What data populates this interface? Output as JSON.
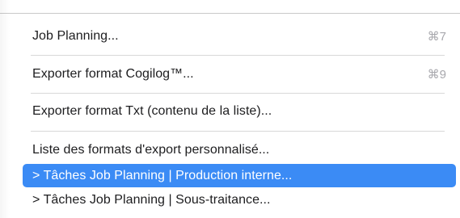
{
  "menu": {
    "items": [
      {
        "label": "Job Planning...",
        "shortcut": "⌘7"
      },
      {
        "label": "Exporter format Cogilog™...",
        "shortcut": "⌘9"
      },
      {
        "label": "Exporter format Txt (contenu de la liste)...",
        "shortcut": ""
      },
      {
        "label": "Liste des formats d'export personnalisé...",
        "shortcut": ""
      },
      {
        "label": "> Tâches Job Planning | Production interne...",
        "shortcut": "",
        "selected": true
      },
      {
        "label": "> Tâches Job Planning | Sous-traitance...",
        "shortcut": ""
      }
    ]
  },
  "colors": {
    "selection": "#3b8bf5",
    "text": "#1d1d1f",
    "shortcut": "#a8a8ad",
    "separator": "#d8d8d8"
  }
}
